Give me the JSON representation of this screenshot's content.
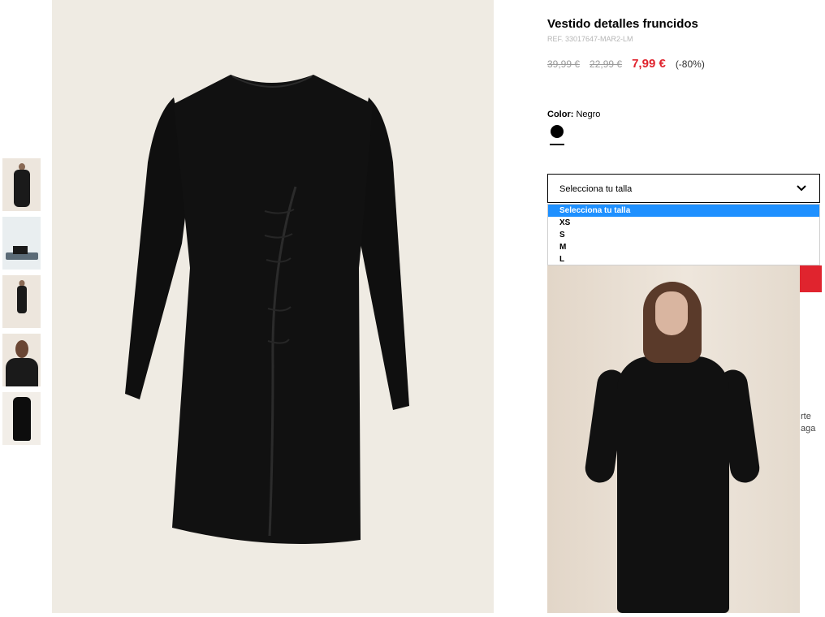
{
  "product": {
    "title": "Vestido detalles fruncidos",
    "ref": "REF. 33017647-MAR2-LM",
    "price_original": "39,99 €",
    "price_previous": "22,99 €",
    "price_sale": "7,99 €",
    "discount": "(-80%)",
    "sale_color": "#e0242e"
  },
  "color": {
    "label": "Color:",
    "value": "Negro",
    "swatch_hex": "#000000"
  },
  "size_select": {
    "placeholder": "Selecciona tu talla",
    "options": [
      "Selecciona tu talla",
      "XS",
      "S",
      "M",
      "L"
    ],
    "highlight_color": "#1e90ff"
  },
  "side_fragments": [
    "rte",
    "aga"
  ],
  "icons": {
    "select_chevron": "chevron-down-icon"
  }
}
